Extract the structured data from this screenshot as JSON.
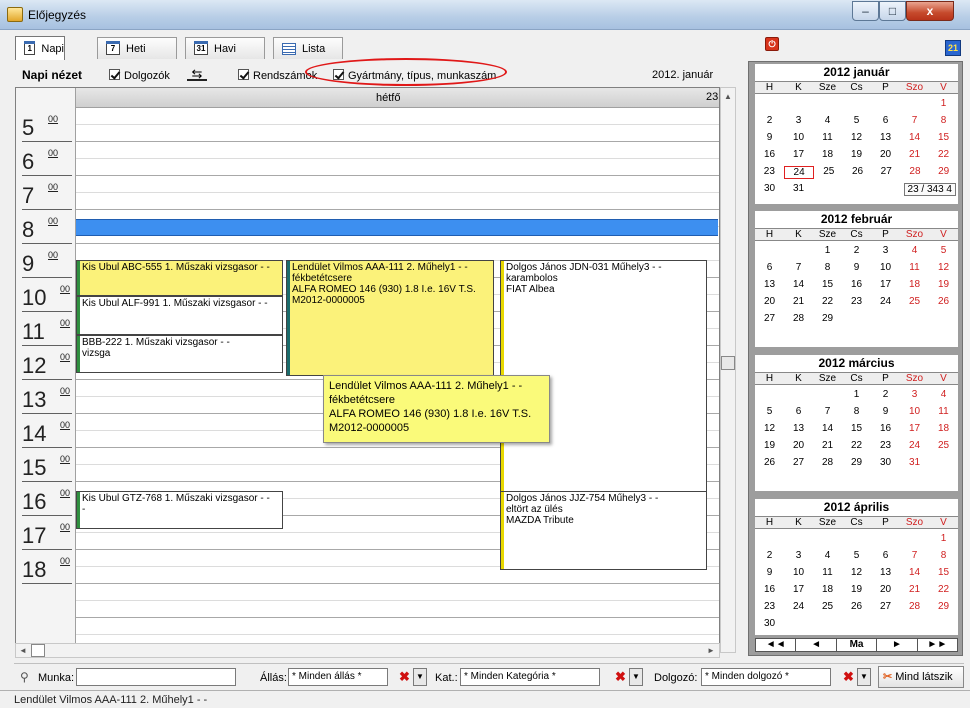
{
  "window": {
    "title": "Előjegyzés",
    "min": "–",
    "max": "□",
    "close": "x"
  },
  "tabs": [
    {
      "icon": "1",
      "label": "Napi"
    },
    {
      "icon": "7",
      "label": "Heti"
    },
    {
      "icon": "31",
      "label": "Havi"
    },
    {
      "label": "Lista"
    }
  ],
  "toolbar": {
    "view_title": "Napi nézet",
    "workers_label": "Dolgozók",
    "plates_label": "Rendszámok",
    "make_label": "Gyártmány, típus, munkaszám",
    "date_label": "2012. január"
  },
  "icons": {
    "power": "power-icon",
    "sort": "sort-icon",
    "swap": "swap-arrows-icon"
  },
  "day": {
    "name": "hétfő",
    "num": "23.",
    "hours": [
      {
        "h": "5",
        "m": "00"
      },
      {
        "h": "6",
        "m": "00"
      },
      {
        "h": "7",
        "m": "00"
      },
      {
        "h": "8",
        "m": "00"
      },
      {
        "h": "9",
        "m": "00"
      },
      {
        "h": "10",
        "m": "00"
      },
      {
        "h": "11",
        "m": "00"
      },
      {
        "h": "12",
        "m": "00"
      },
      {
        "h": "13",
        "m": "00"
      },
      {
        "h": "14",
        "m": "00"
      },
      {
        "h": "15",
        "m": "00"
      },
      {
        "h": "16",
        "m": "00"
      },
      {
        "h": "17",
        "m": "00"
      },
      {
        "h": "18",
        "m": "00"
      }
    ]
  },
  "appointments": [
    {
      "lines": [
        "Kis Ubul ABC-555 1. Műszaki vizsgasor - -"
      ],
      "style": "yellow",
      "bar": "#2f8f3f"
    },
    {
      "lines": [
        "Kis Ubul ALF-991 1. Műszaki vizsgasor - -"
      ],
      "style": "white",
      "bar": "#2f8f3f"
    },
    {
      "lines": [
        "BBB-222 1. Műszaki vizsgasor - -",
        "vizsga"
      ],
      "style": "white",
      "bar": "#2f8f3f"
    },
    {
      "lines": [
        "Lendület Vilmos AAA-111 2. Műhely1 - -",
        "fékbetétcsere",
        "ALFA ROMEO 146 (930) 1.8 I.e. 16V T.S.",
        "M2012-0000005"
      ],
      "style": "yellow",
      "bar": "#1c6c6c"
    },
    {
      "lines": [
        "Dolgos János JDN-031 Műhely3 - -",
        "karambolos",
        "FIAT Albea"
      ],
      "style": "white",
      "bar": "#e8d800"
    },
    {
      "lines": [
        "Kis Ubul GTZ-768 1. Műszaki vizsgasor - -",
        "-"
      ],
      "style": "white",
      "bar": "#2f8f3f"
    },
    {
      "lines": [
        "Dolgos János JJZ-754 Műhely3 - -",
        "eltört az ülés",
        "MAZDA Tribute"
      ],
      "style": "white",
      "bar": "#e8d800"
    }
  ],
  "tooltip": [
    "Lendület Vilmos AAA-111 2. Műhely1 - -",
    "fékbetétcsere",
    "ALFA ROMEO 146 (930) 1.8 I.e. 16V T.S.",
    "M2012-0000005"
  ],
  "calendar": {
    "weekdays": [
      "H",
      "K",
      "Sze",
      "Cs",
      "P",
      "Szo",
      "V"
    ],
    "months": [
      {
        "title": "2012 január",
        "rows": [
          [
            "",
            "",
            "",
            "",
            "",
            "",
            "1"
          ],
          [
            "2",
            "3",
            "4",
            "5",
            "6",
            "7",
            "8"
          ],
          [
            "9",
            "10",
            "11",
            "12",
            "13",
            "14",
            "15"
          ],
          [
            "16",
            "17",
            "18",
            "19",
            "20",
            "21",
            "22"
          ],
          [
            "23",
            "24",
            "25",
            "26",
            "27",
            "28",
            "29"
          ],
          [
            "30",
            "31",
            "",
            "",
            "",
            "",
            ""
          ]
        ],
        "selected": "24",
        "footer": "23 / 343  4"
      },
      {
        "title": "2012 február",
        "rows": [
          [
            "",
            "",
            "1",
            "2",
            "3",
            "4",
            "5"
          ],
          [
            "6",
            "7",
            "8",
            "9",
            "10",
            "11",
            "12"
          ],
          [
            "13",
            "14",
            "15",
            "16",
            "17",
            "18",
            "19"
          ],
          [
            "20",
            "21",
            "22",
            "23",
            "24",
            "25",
            "26"
          ],
          [
            "27",
            "28",
            "29",
            "",
            "",
            "",
            ""
          ]
        ]
      },
      {
        "title": "2012 március",
        "rows": [
          [
            "",
            "",
            "",
            "1",
            "2",
            "3",
            "4"
          ],
          [
            "5",
            "6",
            "7",
            "8",
            "9",
            "10",
            "11"
          ],
          [
            "12",
            "13",
            "14",
            "15",
            "16",
            "17",
            "18"
          ],
          [
            "19",
            "20",
            "21",
            "22",
            "23",
            "24",
            "25"
          ],
          [
            "26",
            "27",
            "28",
            "29",
            "30",
            "31",
            ""
          ]
        ]
      },
      {
        "title": "2012 április",
        "rows": [
          [
            "",
            "",
            "",
            "",
            "",
            "",
            "1"
          ],
          [
            "2",
            "3",
            "4",
            "5",
            "6",
            "7",
            "8"
          ],
          [
            "9",
            "10",
            "11",
            "12",
            "13",
            "14",
            "15"
          ],
          [
            "16",
            "17",
            "18",
            "19",
            "20",
            "21",
            "22"
          ],
          [
            "23",
            "24",
            "25",
            "26",
            "27",
            "28",
            "29"
          ],
          [
            "30",
            "",
            "",
            "",
            "",
            "",
            ""
          ]
        ]
      }
    ],
    "nav": [
      "◄◄",
      "◄",
      "Ma",
      "►",
      "►►"
    ]
  },
  "filters": {
    "work_label": "Munka:",
    "status_label": "Állás:",
    "status_value": "* Minden állás *",
    "category_label": "Kat.:",
    "category_value": "* Minden Kategória *",
    "worker_label": "Dolgozó:",
    "worker_value": "* Minden dolgozó *",
    "show_all": "Mind látszik"
  },
  "status": "Lendület Vilmos AAA-111 2. Műhely1 - -"
}
